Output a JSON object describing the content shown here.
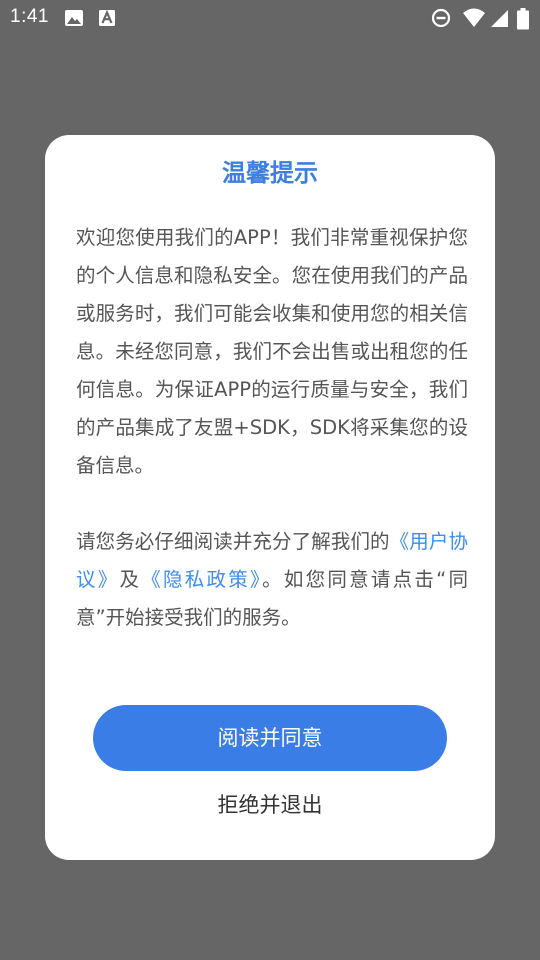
{
  "status_bar": {
    "time": "1:41",
    "icons": [
      "image-icon",
      "text-a-icon",
      "do-not-disturb-icon",
      "wifi-icon",
      "signal-icon",
      "battery-icon"
    ]
  },
  "dialog": {
    "title": "温馨提示",
    "para1": "欢迎您使用我们的APP！我们非常重视保护您的个人信息和隐私安全。您在使用我们的产品或服务时，我们可能会收集和使用您的相关信息。未经您同意，我们不会出售或出租您的任何信息。为保证APP的运行质量与安全，我们的产品集成了友盟+SDK，SDK将采集您的设备信息。",
    "para2_before": "请您务必仔细阅读并充分了解我们的",
    "user_agreement_link": "《用户协议》",
    "para2_middle": "及",
    "privacy_policy_link": "《隐私政策》",
    "para2_after": "。如您同意请点击“同意”开始接受我们的服务。",
    "agree_label": "阅读并同意",
    "exit_label": "拒绝并退出"
  },
  "colors": {
    "overlay": "#666666",
    "title": "#3d7fe0",
    "link": "#3d8df2",
    "button": "#3b7de6"
  }
}
